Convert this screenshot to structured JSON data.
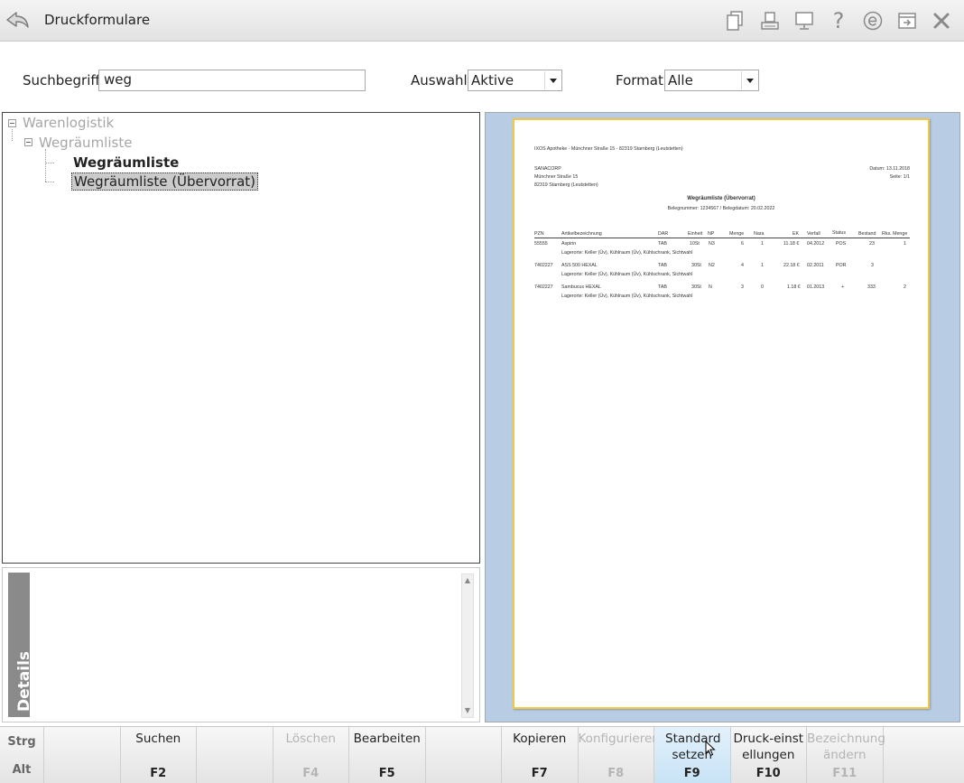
{
  "window": {
    "title": "Druckformulare"
  },
  "toolbar_icons": [
    "copy-icon",
    "printer-icon",
    "monitor-icon",
    "help-icon",
    "internet-icon",
    "export-icon",
    "close-icon"
  ],
  "toolbar_help_glyph": "?",
  "filters": {
    "search_label": "Suchbegriff",
    "search_value": "weg",
    "auswahl_label": "Auswahl",
    "auswahl_value": "Aktive",
    "format_label": "Format",
    "format_value": "Alle"
  },
  "tree": {
    "root": "Warenlogistik",
    "group": "Wegräumliste",
    "items": [
      "Wegräumliste",
      "Wegräumliste (Übervorrat)"
    ],
    "selected": "Wegräumliste (Übervorrat)"
  },
  "details": {
    "tab_label": "Details"
  },
  "preview_doc": {
    "header_line": "IXOS Apotheke - Münchner Straße 15 - 82319 Starnberg (Leutstetten)",
    "address": [
      "SANACORP",
      "Münchner Straße 15",
      "82319 Starnberg (Leutstetten)"
    ],
    "date": "Datum: 13.11.2018",
    "page": "Seite: 1/1",
    "title": "Wegräumliste (Übervorrat)",
    "subtitle": "Belegnummer: 1234567 / Belegdatum: 20.02.2022",
    "columns": [
      "PZN",
      "Artikelbezeichnung",
      "DAR",
      "Einheit",
      "NP",
      "Menge",
      "Nara",
      "EK",
      "Verfall",
      "Status",
      "Bestand",
      "Rks. Menge"
    ],
    "rows": [
      {
        "pzn": "55555",
        "name": "Aspirin",
        "dar": "TAB",
        "einheit": "10St",
        "np": "N3",
        "menge": "6",
        "nara": "1",
        "ek": "11.18 €",
        "verfall": "04.2012",
        "status": "POS",
        "bestand": "23",
        "rks": "1",
        "lager": "Lagerorte: Keller (Üv), Kühlraum (Üv), Kühlschrank, Sichtwahl"
      },
      {
        "pzn": "7402227",
        "name": "ASS 500 HEXAL",
        "dar": "TAB",
        "einheit": "30St",
        "np": "N2",
        "menge": "4",
        "nara": "1",
        "ek": "22.18 €",
        "verfall": "02.2011",
        "status": "POR",
        "bestand": "3",
        "rks": "",
        "lager": "Lagerorte: Keller (Üv), Kühlraum (Üv), Kühlschrank, Sichtwahl"
      },
      {
        "pzn": "7402227",
        "name": "Sambucus HEXAL",
        "dar": "TAB",
        "einheit": "30St",
        "np": "N",
        "menge": "3",
        "nara": "0",
        "ek": "1.18 €",
        "verfall": "01.2013",
        "status": "+",
        "bestand": "333",
        "rks": "2",
        "lager": "Lagerorte: Keller (Üv), Kühlraum (Üv), Kühlschrank, Sichtwahl"
      }
    ]
  },
  "fkeys": {
    "modifier_1": "Strg",
    "modifier_2": "Alt",
    "keys": [
      {
        "label": "",
        "key": "",
        "state": "normal"
      },
      {
        "label": "Suchen",
        "key": "F2",
        "state": "normal"
      },
      {
        "label": "",
        "key": "",
        "state": "normal"
      },
      {
        "label": "Löschen",
        "key": "F4",
        "state": "disabled"
      },
      {
        "label": "Bearbeiten",
        "key": "F5",
        "state": "normal"
      },
      {
        "label": "",
        "key": "",
        "state": "normal"
      },
      {
        "label": "Kopieren",
        "key": "F7",
        "state": "normal"
      },
      {
        "label": "Konfigurieren",
        "key": "F8",
        "state": "disabled"
      },
      {
        "label": "Standard setzen",
        "key": "F9",
        "state": "active"
      },
      {
        "label": "Druck-einstellungen",
        "key": "F10",
        "state": "normal"
      },
      {
        "label": "Bezeichnung ändern",
        "key": "F11",
        "state": "disabled"
      },
      {
        "label": "",
        "key": "",
        "state": "normal"
      }
    ]
  }
}
